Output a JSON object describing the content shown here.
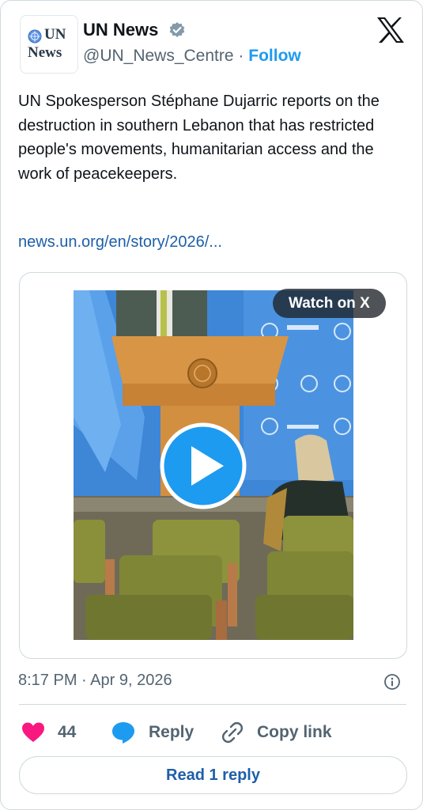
{
  "author": {
    "avatar_lines": [
      "UN",
      "News"
    ],
    "name": "UN News",
    "handle": "@UN_News_Centre",
    "separator": "·",
    "follow_label": "Follow"
  },
  "tweet": {
    "text": "UN Spokesperson Stéphane Dujarric reports on the destruction in southern Lebanon that has restricted people's movements, humanitarian access and the work of peacekeepers.",
    "link": "news.un.org/en/story/2026/..."
  },
  "media": {
    "watch_label": "Watch on X"
  },
  "meta": {
    "timestamp": "8:17 PM · Apr 9, 2026"
  },
  "actions": {
    "like_count": "44",
    "reply_label": "Reply",
    "copy_label": "Copy link"
  },
  "read_replies_label": "Read 1 reply",
  "colors": {
    "accent": "#1d9bf0",
    "link": "#1d5fa8",
    "like": "#f91880",
    "muted": "#536471"
  }
}
